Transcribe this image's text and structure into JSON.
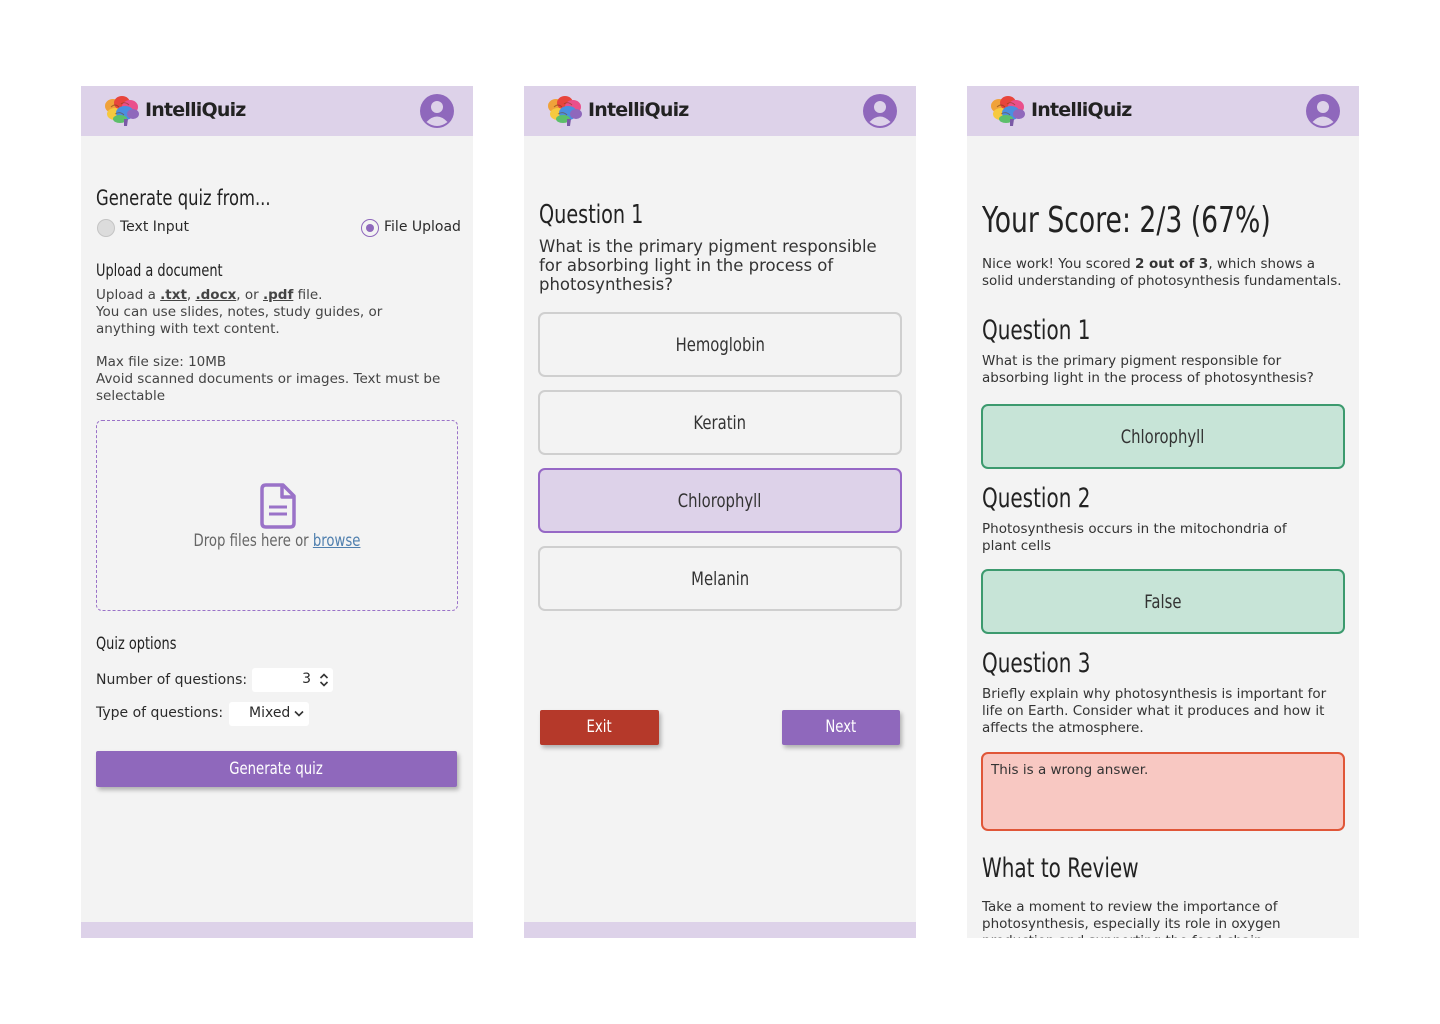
{
  "app": {
    "name": "IntelliQuiz"
  },
  "colors": {
    "accent": "#8f68bc",
    "header": "#ddd2e9",
    "correct": "#c7e4d7",
    "wrong": "#f8c8c2",
    "exit": "#b5392a"
  },
  "icons": {
    "logo": "brain-logo-icon",
    "avatar": "user-avatar-icon",
    "document": "document-icon"
  },
  "setup": {
    "title": "Generate quiz from...",
    "source_options": [
      {
        "label": "Text Input",
        "selected": false
      },
      {
        "label": "File Upload",
        "selected": true
      }
    ],
    "upload_heading": "Upload a document",
    "upload_prefix": "Upload a ",
    "ext_txt": ".txt",
    "comma1": ", ",
    "ext_docx": ".docx",
    "comma_or": ", or ",
    "ext_pdf": ".pdf",
    "file_suffix": " file.",
    "upload_hint": "You can use slides, notes, study guides, or anything with text content.",
    "max_size": "Max file size: 10MB",
    "scan_warning": "Avoid scanned documents or images. Text must be selectable",
    "drop_text": "Drop files here or ",
    "browse_label": "browse",
    "options_heading": "Quiz options",
    "num_questions_label": "Number of questions:",
    "num_questions_value": "3",
    "type_label": "Type of questions:",
    "type_value": "Mixed",
    "generate_label": "Generate quiz"
  },
  "quiz": {
    "question_title": "Question 1",
    "question_text": "What is the primary pigment responsible for absorbing light in the process of photosynthesis?",
    "options": [
      {
        "label": "Hemoglobin",
        "selected": false
      },
      {
        "label": "Keratin",
        "selected": false
      },
      {
        "label": "Chlorophyll",
        "selected": true
      },
      {
        "label": "Melanin",
        "selected": false
      }
    ],
    "exit_label": "Exit",
    "next_label": "Next"
  },
  "results": {
    "score_title": "Your Score: 2/3 (67%)",
    "summary_prefix": "Nice work! You scored ",
    "summary_bold": "2 out of 3",
    "summary_suffix": ", which shows a solid understanding of photosynthesis fundamentals.",
    "questions": [
      {
        "title": "Question 1",
        "text": "What is the primary pigment responsible for absorbing light in the process of photosynthesis?",
        "answer": "Chlorophyll",
        "status": "correct"
      },
      {
        "title": "Question 2",
        "text": "Photosynthesis occurs in the mitochondria of plant cells",
        "answer": "False",
        "status": "correct"
      },
      {
        "title": "Question 3",
        "text": "Briefly explain why photosynthesis is important for life on Earth. Consider what it produces and how it affects the atmosphere.",
        "answer": "This is a wrong answer.",
        "status": "wrong"
      }
    ],
    "review_title": "What to Review",
    "review_text": "Take a moment to review the importance of photosynthesis, especially its role in oxygen production and supporting the food chain. Key points"
  }
}
